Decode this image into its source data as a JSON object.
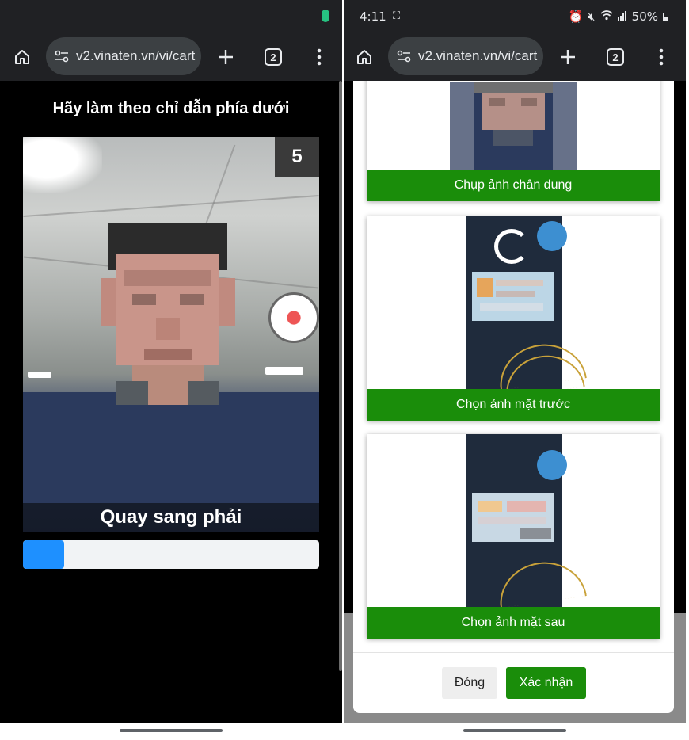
{
  "left_screen": {
    "browser": {
      "url": "v2.vinaten.vn/vi/cart",
      "tab_count": "2"
    },
    "instruction": "Hãy làm theo chỉ dẫn phía dưới",
    "countdown": "5",
    "action": "Quay sang phải",
    "progress_fraction": 0.14
  },
  "right_screen": {
    "status_bar": {
      "time": "4:11",
      "battery": "50%"
    },
    "browser": {
      "url": "v2.vinaten.vn/vi/cart",
      "tab_count": "2"
    },
    "cards": [
      {
        "button_label": "Chụp ảnh chân dung"
      },
      {
        "button_label": "Chọn ảnh mặt trước"
      },
      {
        "button_label": "Chọn ảnh mặt sau"
      }
    ],
    "footer": {
      "close_label": "Đóng",
      "confirm_label": "Xác nhận"
    }
  },
  "colors": {
    "accent_green": "#1a8d0a",
    "progress_blue": "#1e90ff",
    "browser_chrome": "#202124"
  },
  "icons": [
    "home-icon",
    "site-settings-icon",
    "new-tab-plus-icon",
    "tab-switcher-icon",
    "more-menu-icon",
    "loading-spinner-icon"
  ]
}
